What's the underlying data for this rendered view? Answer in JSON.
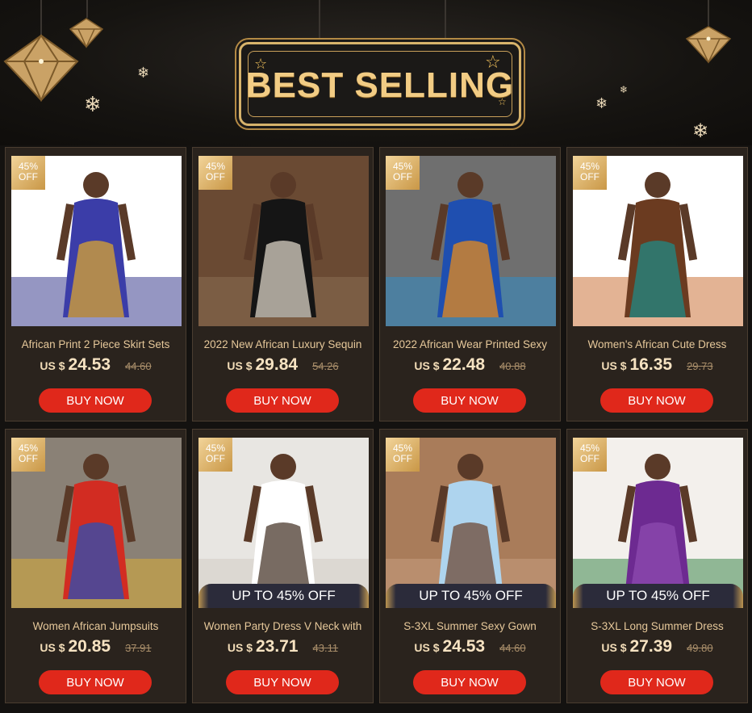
{
  "banner": {
    "title": "BEST SELLING",
    "colors": {
      "gold": "#f2cc84",
      "background": "#141210"
    }
  },
  "currency_label": "US $",
  "buy_label": "BUY NOW",
  "promo_label": "UP TO 45% OFF",
  "products": [
    {
      "discount_line1": "45%",
      "discount_line2": "OFF",
      "name": "African Print 2 Piece Skirt Sets",
      "price": "24.53",
      "old_price": "44.60",
      "promo": false
    },
    {
      "discount_line1": "45%",
      "discount_line2": "OFF",
      "name": "2022 New African Luxury Sequin",
      "price": "29.84",
      "old_price": "54.26",
      "promo": false
    },
    {
      "discount_line1": "45%",
      "discount_line2": "OFF",
      "name": "2022 African Wear Printed Sexy",
      "price": "22.48",
      "old_price": "40.88",
      "promo": false
    },
    {
      "discount_line1": "45%",
      "discount_line2": "OFF",
      "name": "Women's African Cute Dress",
      "price": "16.35",
      "old_price": "29.73",
      "promo": false
    },
    {
      "discount_line1": "45%",
      "discount_line2": "OFF",
      "name": "Women African Jumpsuits",
      "price": "20.85",
      "old_price": "37.91",
      "promo": false
    },
    {
      "discount_line1": "45%",
      "discount_line2": "OFF",
      "name": "Women Party Dress V Neck with",
      "price": "23.71",
      "old_price": "43.11",
      "promo": true
    },
    {
      "discount_line1": "45%",
      "discount_line2": "OFF",
      "name": "S-3XL Summer Sexy Gown",
      "price": "24.53",
      "old_price": "44.60",
      "promo": true
    },
    {
      "discount_line1": "45%",
      "discount_line2": "OFF",
      "name": "S-3XL Long Summer Dress",
      "price": "27.39",
      "old_price": "49.80",
      "promo": true
    }
  ]
}
